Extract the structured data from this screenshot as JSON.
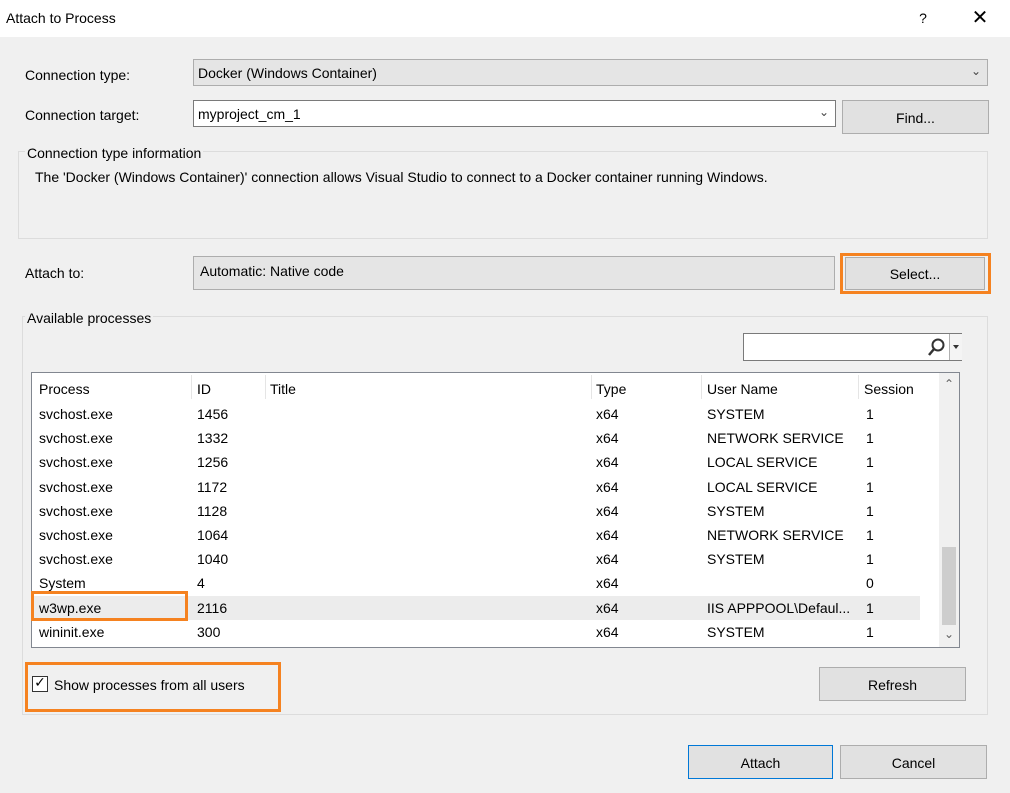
{
  "window": {
    "title": "Attach to Process",
    "help_label": "?",
    "close_label": "✕"
  },
  "connection": {
    "type_label": "Connection type:",
    "type_value": "Docker (Windows Container)",
    "target_label": "Connection target:",
    "target_value": "myproject_cm_1",
    "find_label": "Find..."
  },
  "info": {
    "group_label": "Connection type information",
    "text": "The 'Docker (Windows Container)' connection allows Visual Studio to connect to a Docker container running Windows."
  },
  "attach": {
    "label": "Attach to:",
    "value": "Automatic: Native code",
    "select_label": "Select..."
  },
  "processes": {
    "group_label": "Available processes",
    "search_placeholder": "",
    "columns": [
      "Process",
      "ID",
      "Title",
      "Type",
      "User Name",
      "Session"
    ],
    "rows": [
      {
        "process": "svchost.exe",
        "id": "1456",
        "title": "",
        "type": "x64",
        "user": "SYSTEM",
        "session": "1"
      },
      {
        "process": "svchost.exe",
        "id": "1332",
        "title": "",
        "type": "x64",
        "user": "NETWORK SERVICE",
        "session": "1"
      },
      {
        "process": "svchost.exe",
        "id": "1256",
        "title": "",
        "type": "x64",
        "user": "LOCAL SERVICE",
        "session": "1"
      },
      {
        "process": "svchost.exe",
        "id": "1172",
        "title": "",
        "type": "x64",
        "user": "LOCAL SERVICE",
        "session": "1"
      },
      {
        "process": "svchost.exe",
        "id": "1128",
        "title": "",
        "type": "x64",
        "user": "SYSTEM",
        "session": "1"
      },
      {
        "process": "svchost.exe",
        "id": "1064",
        "title": "",
        "type": "x64",
        "user": "NETWORK SERVICE",
        "session": "1"
      },
      {
        "process": "svchost.exe",
        "id": "1040",
        "title": "",
        "type": "x64",
        "user": "SYSTEM",
        "session": "1"
      },
      {
        "process": "System",
        "id": "4",
        "title": "",
        "type": "x64",
        "user": "",
        "session": "0"
      },
      {
        "process": "w3wp.exe",
        "id": "2116",
        "title": "",
        "type": "x64",
        "user": "IIS APPPOOL\\Defaul...",
        "session": "1"
      },
      {
        "process": "wininit.exe",
        "id": "300",
        "title": "",
        "type": "x64",
        "user": "SYSTEM",
        "session": "1"
      }
    ],
    "selected_row": 8,
    "show_all_users_label": "Show processes from all users",
    "show_all_users_checked": true,
    "refresh_label": "Refresh"
  },
  "footer": {
    "attach_label": "Attach",
    "cancel_label": "Cancel"
  },
  "colors": {
    "highlight": "#f58220",
    "primary_border": "#0078d7",
    "selected_row": "#ececec"
  }
}
